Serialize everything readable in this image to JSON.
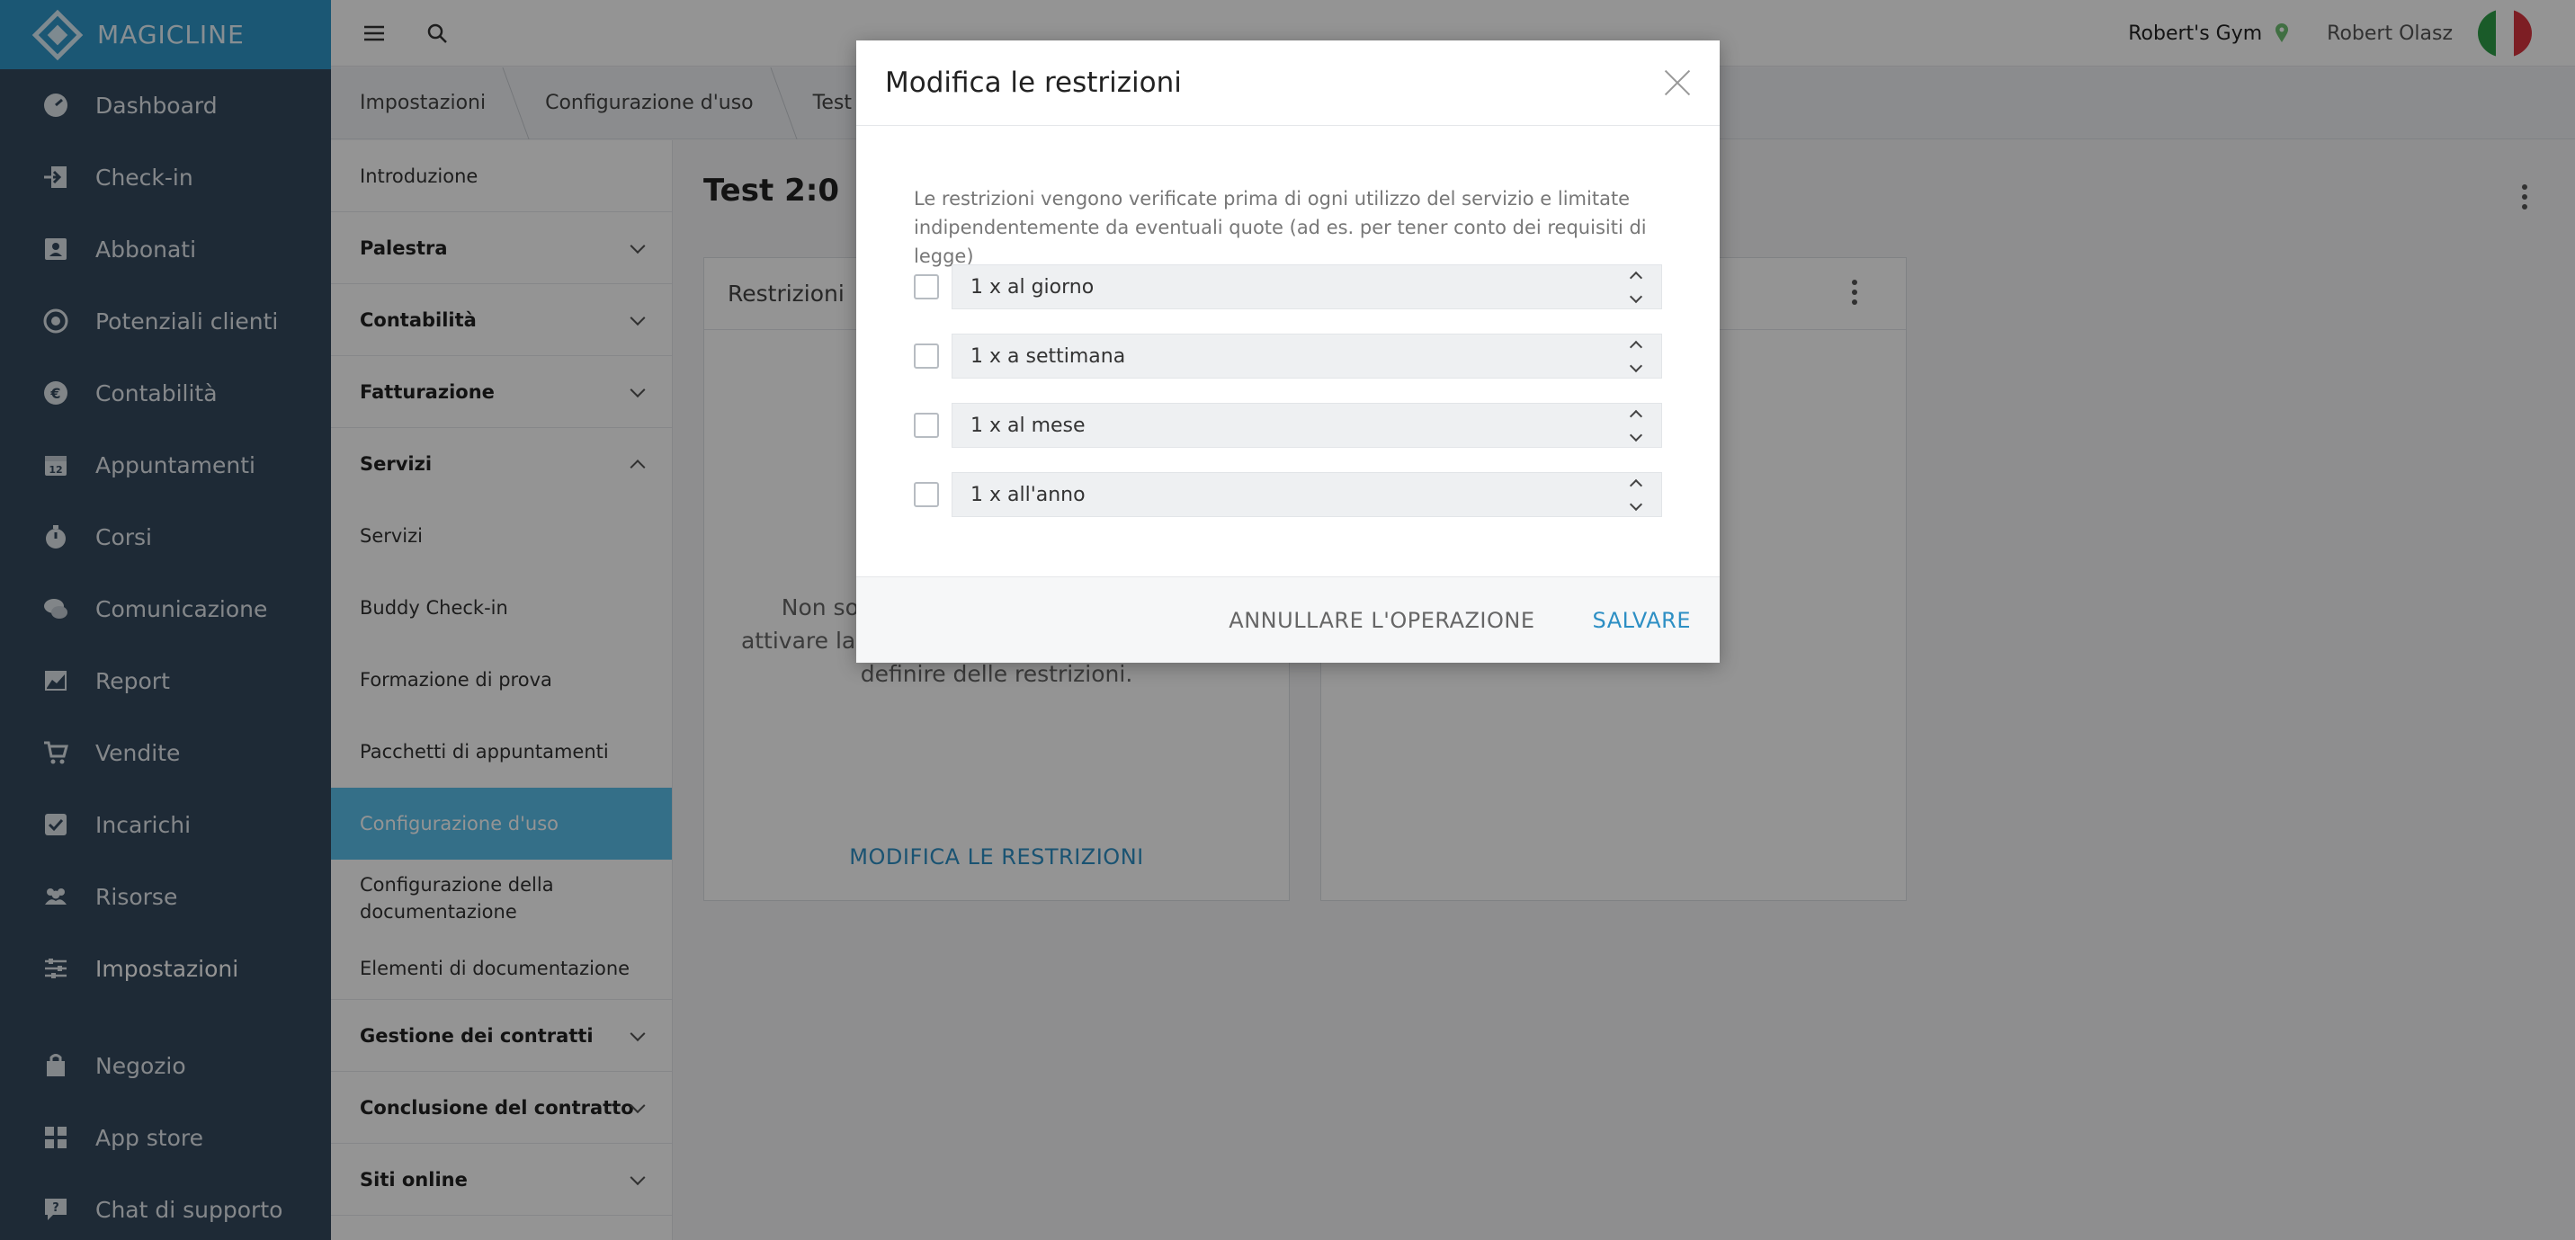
{
  "brand": {
    "name": "MAGICLINE"
  },
  "sidebar": {
    "items": [
      {
        "label": "Dashboard",
        "icon": "dashboard-icon"
      },
      {
        "label": "Check-in",
        "icon": "check-in-icon"
      },
      {
        "label": "Abbonati",
        "icon": "members-icon"
      },
      {
        "label": "Potenziali clienti",
        "icon": "leads-icon"
      },
      {
        "label": "Contabilità",
        "icon": "euro-icon"
      },
      {
        "label": "Appuntamenti",
        "icon": "calendar-icon"
      },
      {
        "label": "Corsi",
        "icon": "stopwatch-icon"
      },
      {
        "label": "Comunicazione",
        "icon": "chat-icon"
      },
      {
        "label": "Report",
        "icon": "chart-icon"
      },
      {
        "label": "Vendite",
        "icon": "cart-icon"
      },
      {
        "label": "Incarichi",
        "icon": "task-icon"
      },
      {
        "label": "Risorse",
        "icon": "people-icon"
      },
      {
        "label": "Impostazioni",
        "icon": "sliders-icon"
      }
    ],
    "bottom_items": [
      {
        "label": "Negozio",
        "icon": "shop-icon"
      },
      {
        "label": "App store",
        "icon": "apps-icon"
      },
      {
        "label": "Chat di supporto",
        "icon": "support-chat-icon"
      }
    ]
  },
  "topbar": {
    "gym": "Robert's Gym",
    "user": "Robert Olasz"
  },
  "breadcrumbs": [
    "Impostazioni",
    "Configurazione d'uso",
    "Test 2:0"
  ],
  "submenu": {
    "introduction": "Introduzione",
    "palestra": "Palestra",
    "contabilita": "Contabilità",
    "fatturazione": "Fatturazione",
    "servizi_head": "Servizi",
    "servizi": "Servizi",
    "buddy": "Buddy Check-in",
    "formazione": "Formazione di prova",
    "pacchetti": "Pacchetti di appuntamenti",
    "configurazione_uso": "Configurazione d'uso",
    "configurazione_doc": "Configurazione della documentazione",
    "elementi_doc": "Elementi di documentazione",
    "gestione_contratti": "Gestione dei contratti",
    "conclusione_contratto": "Conclusione del contratto",
    "siti_online": "Siti online"
  },
  "main": {
    "title": "Test 2:0",
    "card_title": "Restrizioni",
    "card_text": "Non sono state definite restrizioni. Per attivare la configurazione d'uso, è necessario definire delle restrizioni.",
    "card_link": "MODIFICA LE RESTRIZIONI"
  },
  "modal": {
    "title": "Modifica le restrizioni",
    "description": "Le restrizioni vengono verificate prima di ogni utilizzo del servizio e limitate indipendentemente da eventuali quote (ad es. per tener conto dei requisiti di legge)",
    "rows": [
      {
        "value": "1 x al giorno",
        "checked": false
      },
      {
        "value": "1 x a settimana",
        "checked": false
      },
      {
        "value": "1 x al mese",
        "checked": false
      },
      {
        "value": "1 x all'anno",
        "checked": false
      }
    ],
    "cancel_label": "ANNULLARE L'OPERAZIONE",
    "save_label": "SALVARE"
  },
  "colors": {
    "brand": "#2f96c8",
    "sidebar": "#34495e",
    "accent": "#2d8fc4",
    "selected": "#5bc0eb"
  }
}
